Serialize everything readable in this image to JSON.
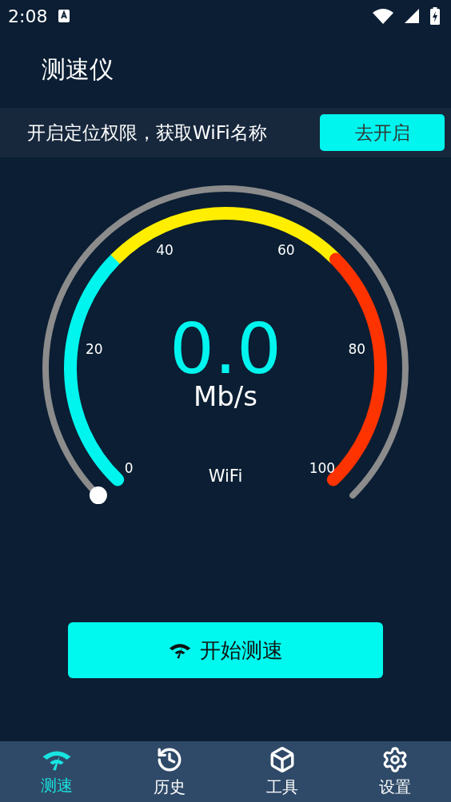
{
  "status_bar": {
    "time": "2:08"
  },
  "header": {
    "title": "测速仪"
  },
  "banner": {
    "text": "开启定位权限，获取WiFi名称",
    "button": "去开启"
  },
  "gauge": {
    "value": "0.0",
    "unit": "Mb/s",
    "network": "WiFi",
    "ticks": [
      "0",
      "20",
      "40",
      "60",
      "80",
      "100"
    ],
    "segments": [
      {
        "color": "#00f5ee"
      },
      {
        "color": "#ffee00"
      },
      {
        "color": "#ff3300"
      }
    ]
  },
  "start_button": {
    "label": "开始测速"
  },
  "nav": [
    {
      "label": "测速",
      "selected": true
    },
    {
      "label": "历史",
      "selected": false
    },
    {
      "label": "工具",
      "selected": false
    },
    {
      "label": "设置",
      "selected": false
    }
  ]
}
